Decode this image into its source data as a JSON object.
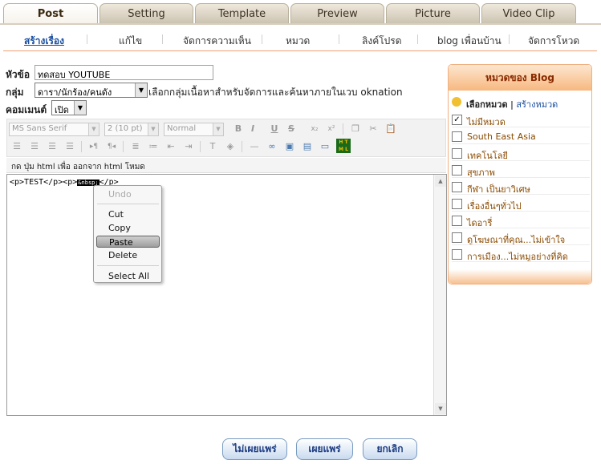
{
  "tabs": [
    {
      "label": "Post",
      "active": true
    },
    {
      "label": "Setting"
    },
    {
      "label": "Template"
    },
    {
      "label": "Preview"
    },
    {
      "label": "Picture"
    },
    {
      "label": "Video Clip"
    }
  ],
  "subnav": [
    {
      "label": "สร้างเรื่อง",
      "active": true
    },
    {
      "label": "แก้ไข"
    },
    {
      "label": "จัดการความเห็น"
    },
    {
      "label": "หมวด"
    },
    {
      "label": "ลิงค์โปรด"
    },
    {
      "label": "blog เพื่อนบ้าน"
    },
    {
      "label": "จัดการโหวด"
    }
  ],
  "form": {
    "title_label": "หัวข้อ",
    "title_value": "ทดสอบ YOUTUBE",
    "group_label": "กลุ่ม",
    "group_value": "ดารา/นักร้อง/คนดัง",
    "group_note": "เลือกกลุ่มเนื้อหาสำหรับจัดการและค้นหาภายในเวบ oknation",
    "comment_label": "คอมเมนต์",
    "comment_value": "เปิด"
  },
  "toolbar": {
    "font": "MS Sans Serif",
    "size": "2 (10 pt)",
    "style": "Normal",
    "html_toggle": "กด ปุ่ม html เพื่อ ออกจาก html โหมด"
  },
  "editor": {
    "code_before": "<p>TEST</p><p>",
    "code_selected": "&nbsp;",
    "code_after": "</p>"
  },
  "context_menu": {
    "undo": "Undo",
    "cut": "Cut",
    "copy": "Copy",
    "paste": "Paste",
    "delete": "Delete",
    "select_all": "Select All"
  },
  "categories": {
    "header": "หมวดของ Blog",
    "choose_label": "เลือกหมวด",
    "divider": "|",
    "create_label": "สร้างหมวด",
    "items": [
      {
        "label": "ไม่มีหมวด",
        "checked": true
      },
      {
        "label": "South East Asia",
        "checked": false
      },
      {
        "label": "เทคโนโลยี",
        "checked": false
      },
      {
        "label": "สุขภาพ",
        "checked": false
      },
      {
        "label": "กีฬา เป็นยาวิเศษ",
        "checked": false
      },
      {
        "label": "เรื่องอื่นๆทั่วไป",
        "checked": false
      },
      {
        "label": "ไดอารี่",
        "checked": false
      },
      {
        "label": "ดูโฆษณาที่คุณ...ไม่เข้าใจ",
        "checked": false
      },
      {
        "label": "การเมือง...ไม่หมูอย่างที่คิด",
        "checked": false
      }
    ]
  },
  "buttons": {
    "no_publish": "ไม่เผยแพร่",
    "publish": "เผยแพร่",
    "cancel": "ยกเลิก"
  },
  "colors": {
    "accent_orange": "#f7b880",
    "link_blue": "#1a4fa0",
    "category_text": "#8a4a00"
  }
}
